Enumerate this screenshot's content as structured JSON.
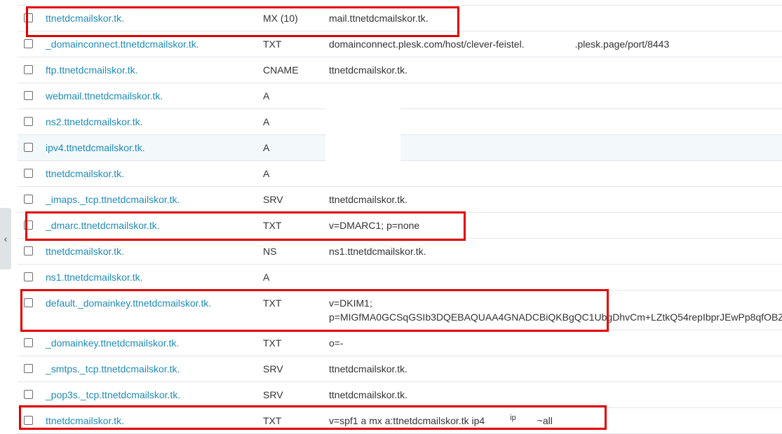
{
  "sidebar": {
    "collapse_label": "‹"
  },
  "annotation_color": "#e00000",
  "link_color": "#1f8bb8",
  "records": [
    {
      "host": "ttnetdcmailskor.tk.",
      "type": "MX (10)",
      "value": "mail.ttnetdcmailskor.tk."
    },
    {
      "host": "_domainconnect.ttnetdcmailskor.tk.",
      "type": "TXT",
      "value_prefix": "domainconnect.plesk.com/host/clever-feistel.",
      "value_suffix": ".plesk.page/port/8443"
    },
    {
      "host": "ftp.ttnetdcmailskor.tk.",
      "type": "CNAME",
      "value": "ttnetdcmailskor.tk."
    },
    {
      "host": "webmail.ttnetdcmailskor.tk.",
      "type": "A",
      "value": ""
    },
    {
      "host": "ns2.ttnetdcmailskor.tk.",
      "type": "A",
      "value": ""
    },
    {
      "host": "ipv4.ttnetdcmailskor.tk.",
      "type": "A",
      "value": ""
    },
    {
      "host": "ttnetdcmailskor.tk.",
      "type": "A",
      "value": ""
    },
    {
      "host": "_imaps._tcp.ttnetdcmailskor.tk.",
      "type": "SRV",
      "value": "ttnetdcmailskor.tk."
    },
    {
      "host": "_dmarc.ttnetdcmailskor.tk.",
      "type": "TXT",
      "value": "v=DMARC1; p=none"
    },
    {
      "host": "ttnetdcmailskor.tk.",
      "type": "NS",
      "value": "ns1.ttnetdcmailskor.tk."
    },
    {
      "host": "ns1.ttnetdcmailskor.tk.",
      "type": "A",
      "value": ""
    },
    {
      "host": "default._domainkey.ttnetdcmailskor.tk.",
      "type": "TXT",
      "value_line1": "v=DKIM1;",
      "value_line2": "p=MIGfMA0GCSqGSIb3DQEBAQUAA4GNADCBiQKBgQC1UbgDhvCm+LZtkQ54repIbprJEwPp8qfOBZ("
    },
    {
      "host": "_domainkey.ttnetdcmailskor.tk.",
      "type": "TXT",
      "value": "o=-"
    },
    {
      "host": "_smtps._tcp.ttnetdcmailskor.tk.",
      "type": "SRV",
      "value": "ttnetdcmailskor.tk."
    },
    {
      "host": "_pop3s._tcp.ttnetdcmailskor.tk.",
      "type": "SRV",
      "value": "ttnetdcmailskor.tk."
    },
    {
      "host": "ttnetdcmailskor.tk.",
      "type": "TXT",
      "value_part1": "v=spf1 a mx a:ttnetdcmailskor.tk ip4",
      "value_ip_label": "ip",
      "value_part2": "~all"
    }
  ]
}
